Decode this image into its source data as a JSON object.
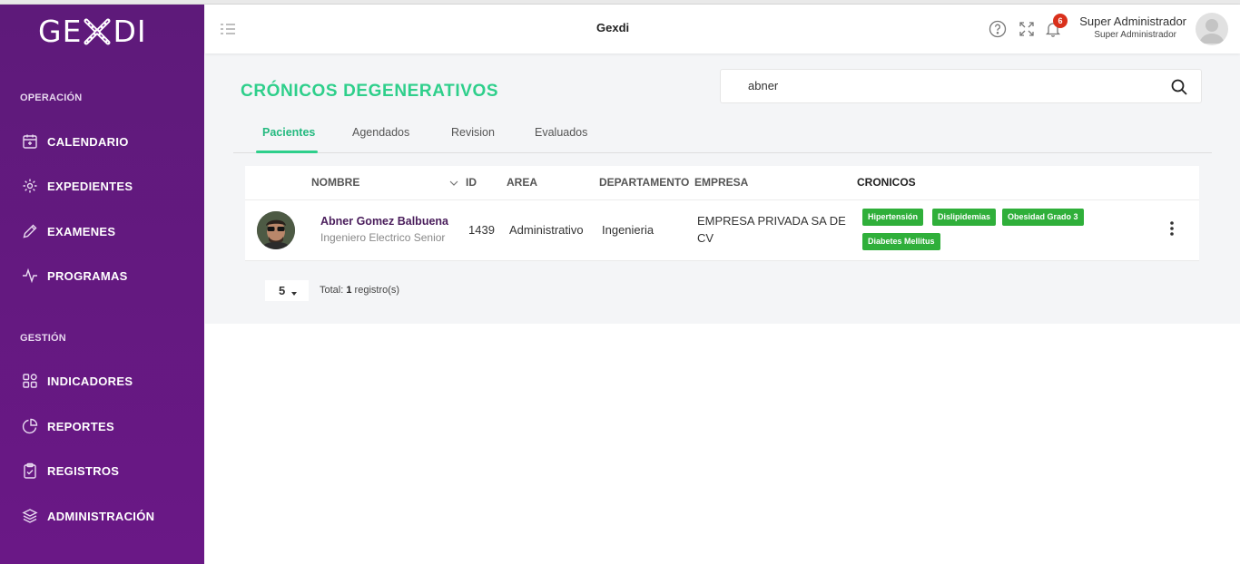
{
  "logo": {
    "left": "GE",
    "right": "DI"
  },
  "sidebar": {
    "sections": [
      {
        "title": "OPERACIÓN"
      },
      {
        "title": "GESTIÓN"
      }
    ],
    "items": [
      {
        "label": "CALENDARIO",
        "icon": "calendar-icon"
      },
      {
        "label": "EXPEDIENTES",
        "icon": "folder-gear-icon"
      },
      {
        "label": "EXAMENES",
        "icon": "pen-icon"
      },
      {
        "label": "PROGRAMAS",
        "icon": "pulse-icon"
      },
      {
        "label": "INDICADORES",
        "icon": "grid-icon"
      },
      {
        "label": "REPORTES",
        "icon": "pie-chart-icon"
      },
      {
        "label": "REGISTROS",
        "icon": "clipboard-check-icon"
      },
      {
        "label": "ADMINISTRACIÓN",
        "icon": "layers-icon"
      }
    ]
  },
  "header": {
    "title": "Gexdi",
    "notifications": "6",
    "user_name": "Super Administrador",
    "user_role": "Super Administrador"
  },
  "page": {
    "title": "CRÓNICOS DEGENERATIVOS",
    "search_value": "abner",
    "tabs": [
      "Pacientes",
      "Agendados",
      "Revision",
      "Evaluados"
    ],
    "active_tab": "Pacientes"
  },
  "table": {
    "headers": [
      "NOMBRE",
      "ID",
      "AREA",
      "DEPARTAMENTO",
      "EMPRESA",
      "CRONICOS"
    ],
    "rows": [
      {
        "name": "Abner Gomez Balbuena",
        "job": "Ingeniero Electrico Senior",
        "id": "1439",
        "area": "Administrativo",
        "departamento": "Ingenieria",
        "empresa_line1": "EMPRESA PRIVADA SA DE",
        "empresa_line2": "CV",
        "cronicos": [
          "Hipertensión",
          "Dislipidemias",
          "Obesidad Grado 3",
          "Diabetes Mellitus"
        ]
      }
    ]
  },
  "pagination": {
    "page_size": "5",
    "total_prefix": "Total:",
    "total_count": "1",
    "total_suffix": "registro(s)"
  },
  "colors": {
    "sidebar": "#5e1a7a",
    "accent": "#2ecf8b",
    "tag": "#2faf3a",
    "badge": "#d9301b"
  }
}
